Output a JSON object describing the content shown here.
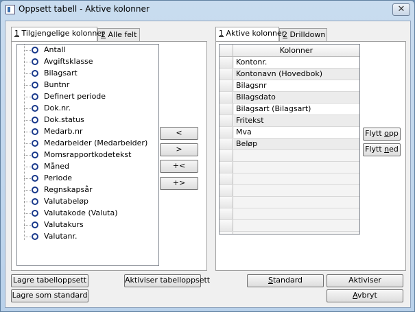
{
  "window": {
    "title": "Oppsett tabell - Aktive kolonner",
    "close_glyph": "✕"
  },
  "left_tabs": [
    {
      "num": "1",
      "label": "Tilgjengelige kolonner"
    },
    {
      "num": "2",
      "label": "Alle felt"
    }
  ],
  "right_tabs": [
    {
      "num": "1",
      "label": "Aktive kolonner"
    },
    {
      "num": "2",
      "label": "Drilldown"
    }
  ],
  "available_columns": [
    "Antall",
    "Avgiftsklasse",
    "Bilagsart",
    "Buntnr",
    "Definert periode",
    "Dok.nr.",
    "Dok.status",
    "Medarb.nr",
    "Medarbeider (Medarbeider)",
    "Momsrapportkodetekst",
    "Måned",
    "Periode",
    "Regnskapsår",
    "Valutabeløp",
    "Valutakode (Valuta)",
    "Valutakurs",
    "Valutanr."
  ],
  "transfer_buttons": {
    "move_left": "<",
    "move_right": ">",
    "add_all": "+<",
    "remove_all": "+>"
  },
  "active_grid": {
    "header": "Kolonner",
    "rows": [
      "Kontonr.",
      "Kontonavn (Hovedbok)",
      "Bilagsnr",
      "Bilagsdato",
      "Bilagsart (Bilagsart)",
      "Fritekst",
      "Mva",
      "Beløp"
    ],
    "empty_rows": 8
  },
  "move_buttons": {
    "up_prefix": "Flytt ",
    "up_key": "o",
    "up_rest": "pp",
    "down_prefix": "Flytt ",
    "down_key": "n",
    "down_rest": "ed"
  },
  "bottom_buttons": {
    "save_layout": "Lagre tabelloppsett",
    "activate_layout": "Aktiviser tabelloppsett",
    "save_default": "Lagre som standard",
    "standard_key": "S",
    "standard_rest": "tandard",
    "activate": "Aktiviser",
    "cancel_key": "A",
    "cancel_rest": "vbryt"
  }
}
